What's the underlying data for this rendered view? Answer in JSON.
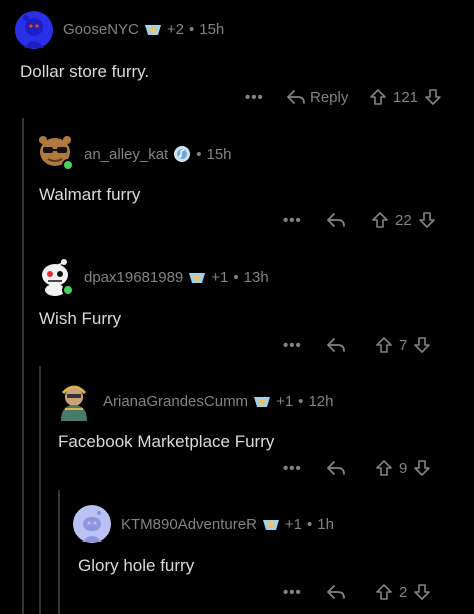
{
  "comments": [
    {
      "username": "GooseNYC",
      "award_extra": "+2",
      "age": "15h",
      "text": "Dollar store furry.",
      "reply_label": "Reply",
      "more": "•••",
      "votes": "121"
    },
    {
      "username": "an_alley_kat",
      "age": "15h",
      "text": "Walmart furry",
      "more": "•••",
      "votes": "22"
    },
    {
      "username": "dpax19681989",
      "award_extra": "+1",
      "age": "13h",
      "text": "Wish Furry",
      "more": "•••",
      "votes": "7"
    },
    {
      "username": "ArianaGrandesCumm",
      "award_extra": "+1",
      "age": "12h",
      "text": "Facebook Marketplace Furry",
      "more": "•••",
      "votes": "9"
    },
    {
      "username": "KTM890AdventureR",
      "award_extra": "+1",
      "age": "1h",
      "text": "Glory hole furry",
      "more": "•••",
      "votes": "2"
    }
  ],
  "separator": "•",
  "colors": {
    "background": "#000000",
    "text": "#d7dadc",
    "muted": "#818384",
    "thread_line": "#343536",
    "online": "#46d160"
  }
}
